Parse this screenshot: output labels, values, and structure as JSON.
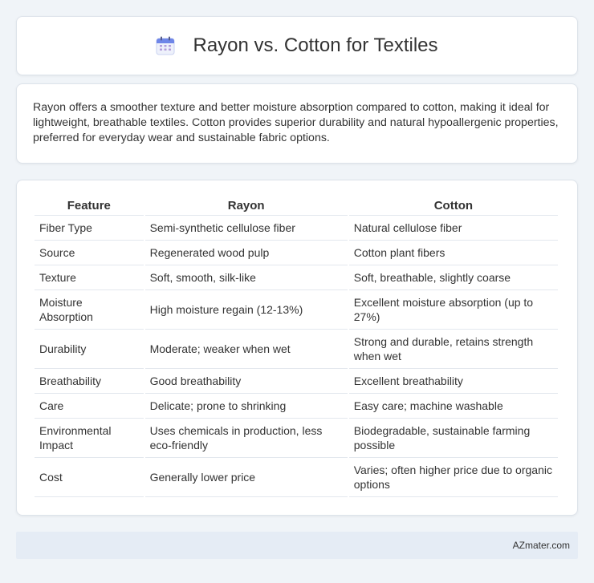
{
  "header": {
    "title": "Rayon vs. Cotton for Textiles",
    "icon": "calendar-icon"
  },
  "summary": {
    "text": "Rayon offers a smoother texture and better moisture absorption compared to cotton, making it ideal for lightweight, breathable textiles. Cotton provides superior durability and natural hypoallergenic properties, preferred for everyday wear and sustainable fabric options."
  },
  "table": {
    "headers": [
      "Feature",
      "Rayon",
      "Cotton"
    ],
    "rows": [
      [
        "Fiber Type",
        "Semi-synthetic cellulose fiber",
        "Natural cellulose fiber"
      ],
      [
        "Source",
        "Regenerated wood pulp",
        "Cotton plant fibers"
      ],
      [
        "Texture",
        "Soft, smooth, silk-like",
        "Soft, breathable, slightly coarse"
      ],
      [
        "Moisture Absorption",
        "High moisture regain (12-13%)",
        "Excellent moisture absorption (up to 27%)"
      ],
      [
        "Durability",
        "Moderate; weaker when wet",
        "Strong and durable, retains strength when wet"
      ],
      [
        "Breathability",
        "Good breathability",
        "Excellent breathability"
      ],
      [
        "Care",
        "Delicate; prone to shrinking",
        "Easy care; machine washable"
      ],
      [
        "Environmental Impact",
        "Uses chemicals in production, less eco-friendly",
        "Biodegradable, sustainable farming possible"
      ],
      [
        "Cost",
        "Generally lower price",
        "Varies; often higher price due to organic options"
      ]
    ]
  },
  "footer": {
    "brand": "AZmater.com"
  },
  "colors": {
    "background": "#f0f4f8",
    "card": "#ffffff",
    "footer": "#e5ecf5",
    "icon_accent": "#7b8ff0"
  }
}
